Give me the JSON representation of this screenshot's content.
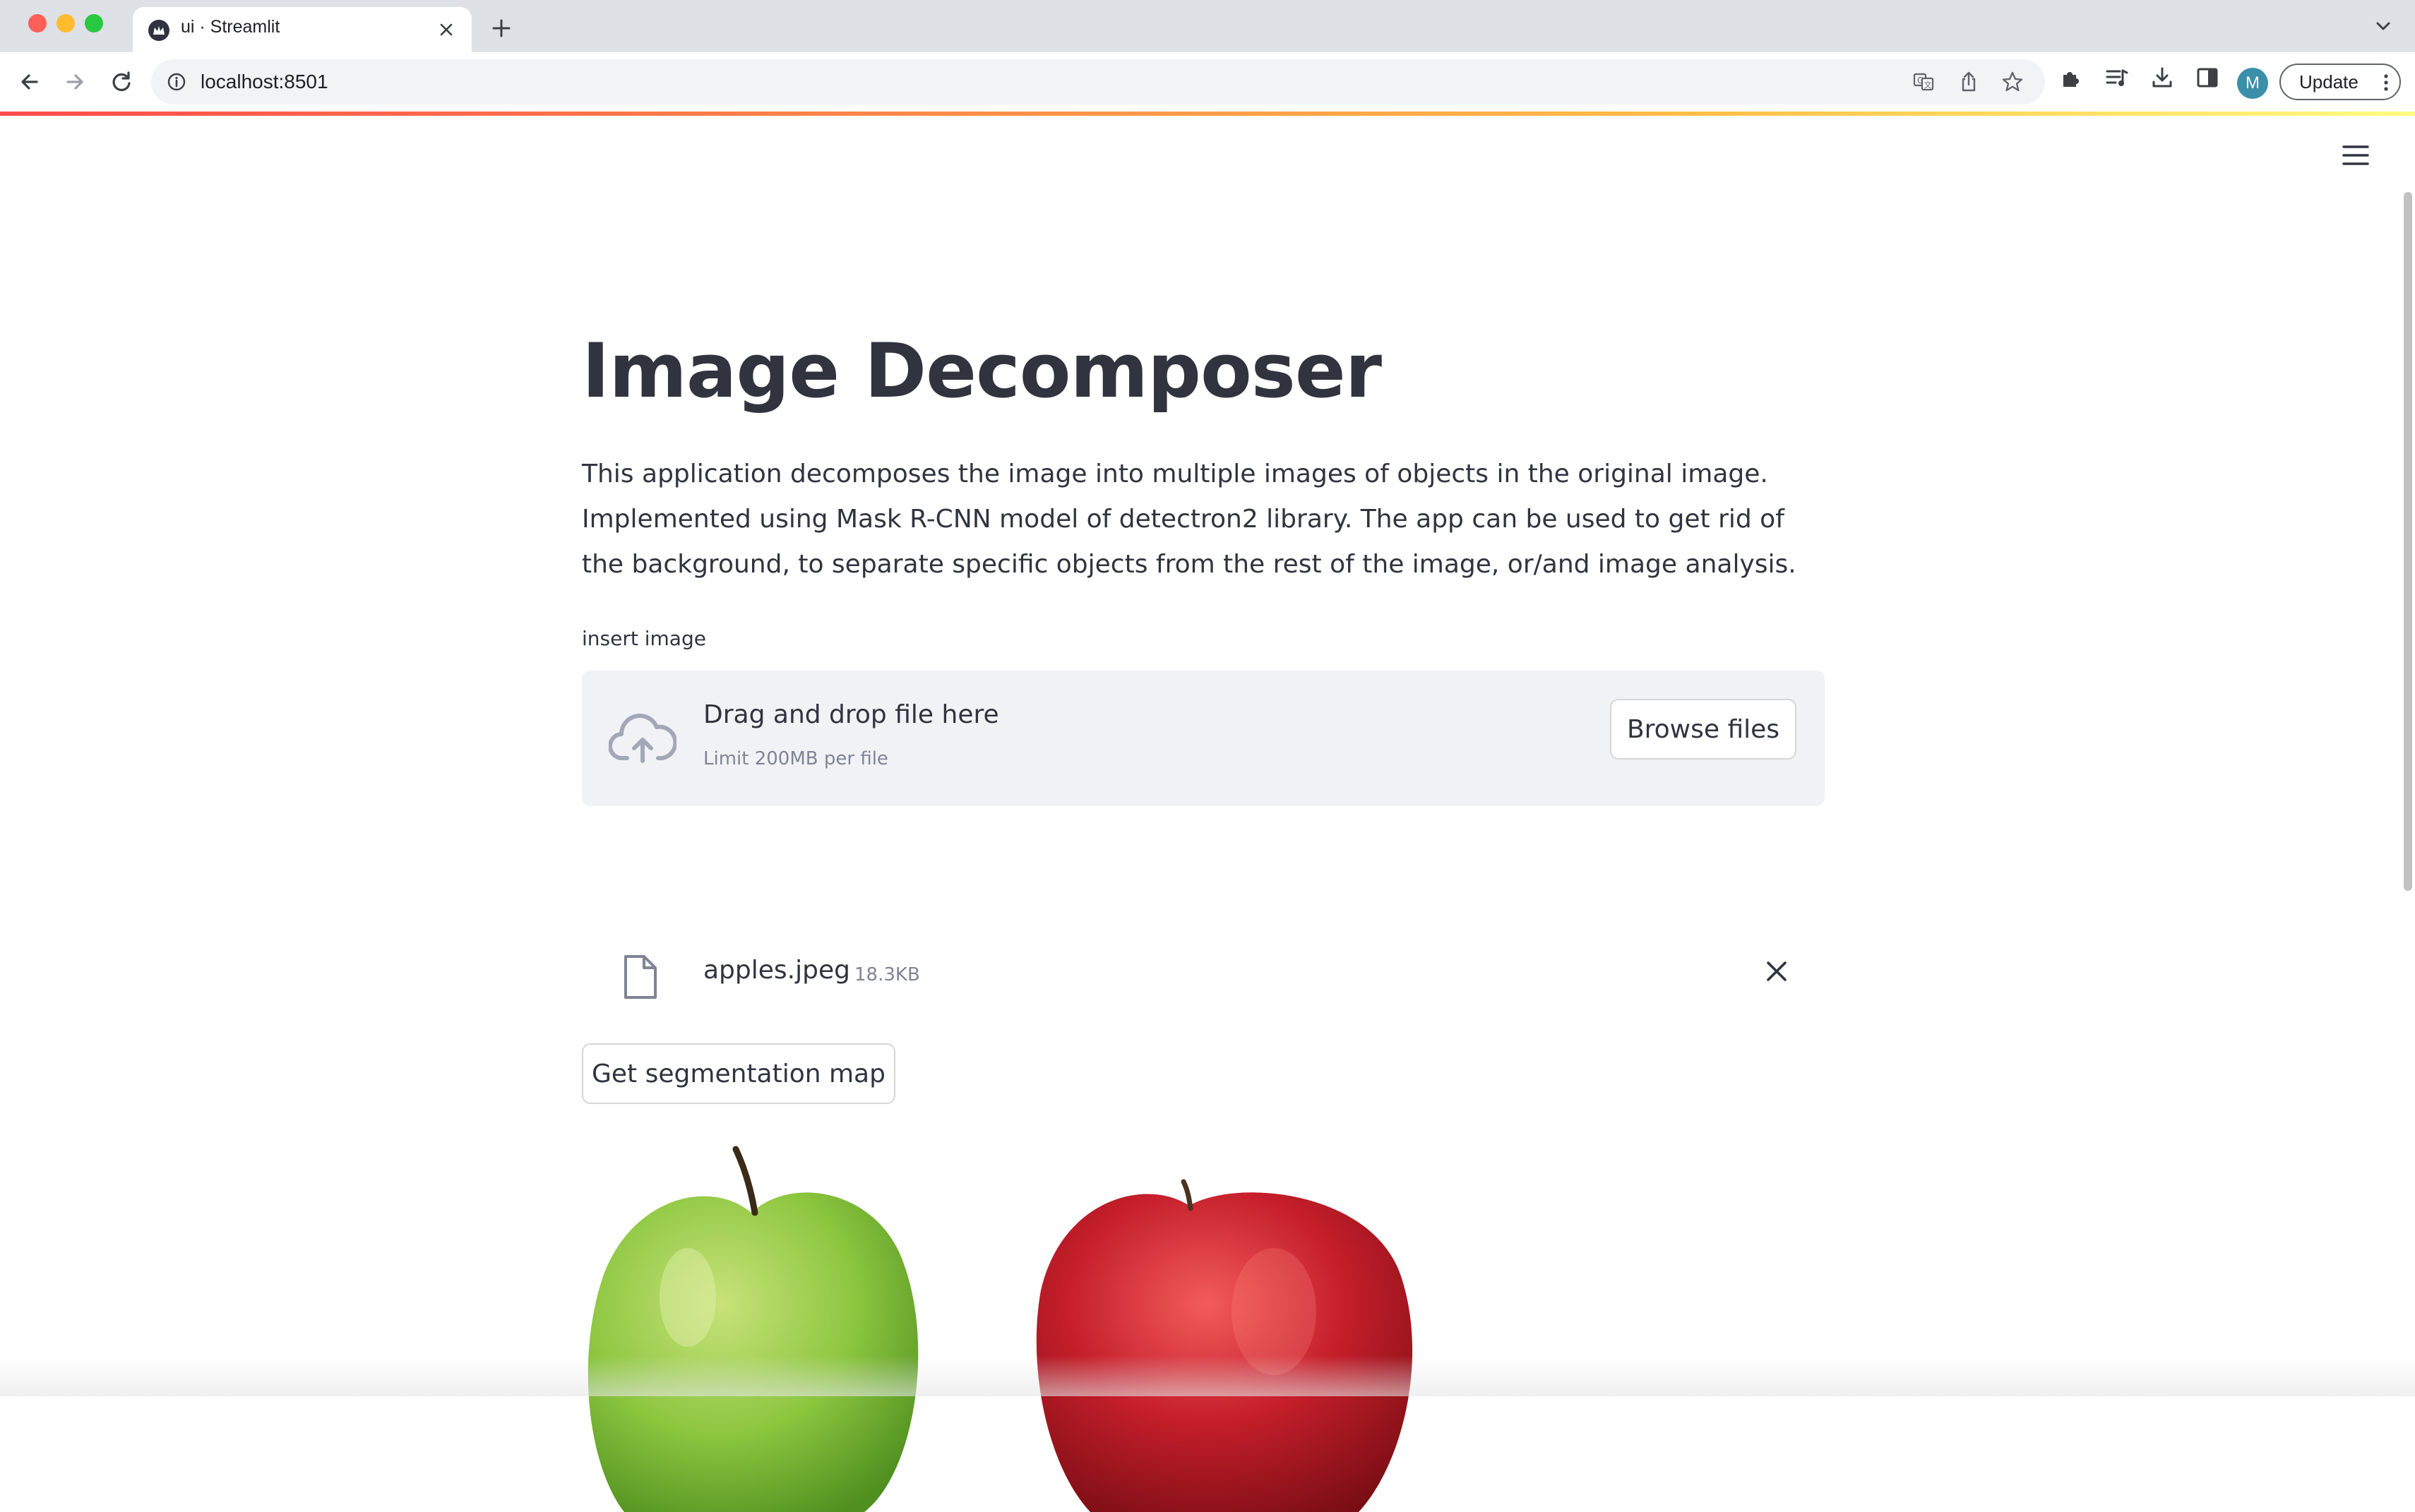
{
  "browser": {
    "tab_title": "ui · Streamlit",
    "url": "localhost:8501",
    "profile_initial": "M",
    "update_label": "Update"
  },
  "app": {
    "title": "Image Decomposer",
    "description": "This application decomposes the image into multiple images of objects in the original image. Implemented using Mask R-CNN model of detectron2 library. The app can be used to get rid of the background, to separate specific objects from the rest of the image, or/and image analysis.",
    "uploader": {
      "label": "insert image",
      "instruction": "Drag and drop file here",
      "limit": "Limit 200MB per file",
      "browse_label": "Browse files"
    },
    "uploaded_file": {
      "name": "apples.jpeg",
      "size": "18.3KB"
    },
    "segment_button_label": "Get segmentation map"
  },
  "colors": {
    "text": "#31333f",
    "muted": "#808495",
    "dropzone_bg": "#f0f2f6",
    "accent_gradient_start": "#ff4b4b",
    "accent_gradient_end": "#fffd80"
  },
  "icons": [
    "streamlit-favicon",
    "close-icon",
    "plus-icon",
    "chevron-down-icon",
    "back-arrow-icon",
    "forward-arrow-icon",
    "reload-icon",
    "info-icon",
    "translate-icon",
    "share-icon",
    "star-icon",
    "extensions-icon",
    "reading-list-icon",
    "download-icon",
    "side-panel-icon",
    "more-vert-icon",
    "hamburger-menu-icon",
    "upload-cloud-icon",
    "file-icon"
  ]
}
